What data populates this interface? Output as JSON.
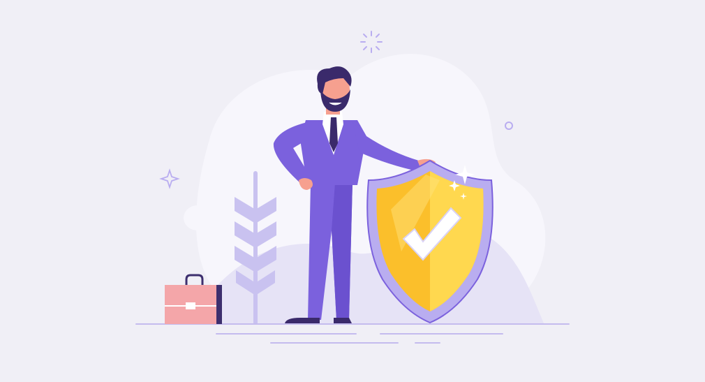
{
  "scene": {
    "subject": "businessman-with-security-shield",
    "colors": {
      "background": "#f0eff6",
      "blob": "#f7f6fc",
      "blob_shade": "#e6e3f6",
      "plant": "#c9c2f0",
      "suit": "#7b61dd",
      "suit_shade": "#5e45bf",
      "skin": "#f6a08f",
      "hair": "#3a2a6b",
      "shield_outer": "#b9adf0",
      "shield_gold": "#fbbf2b",
      "shield_gold_light": "#ffd84f",
      "check": "#ffffff",
      "briefcase": "#f4a6a9",
      "briefcase_dark": "#3d2f6e",
      "ground_line": "#c4bbee"
    },
    "icons": [
      "checkmark-icon",
      "sparkle-icon",
      "star-icon",
      "circle-icon",
      "burst-icon"
    ]
  }
}
